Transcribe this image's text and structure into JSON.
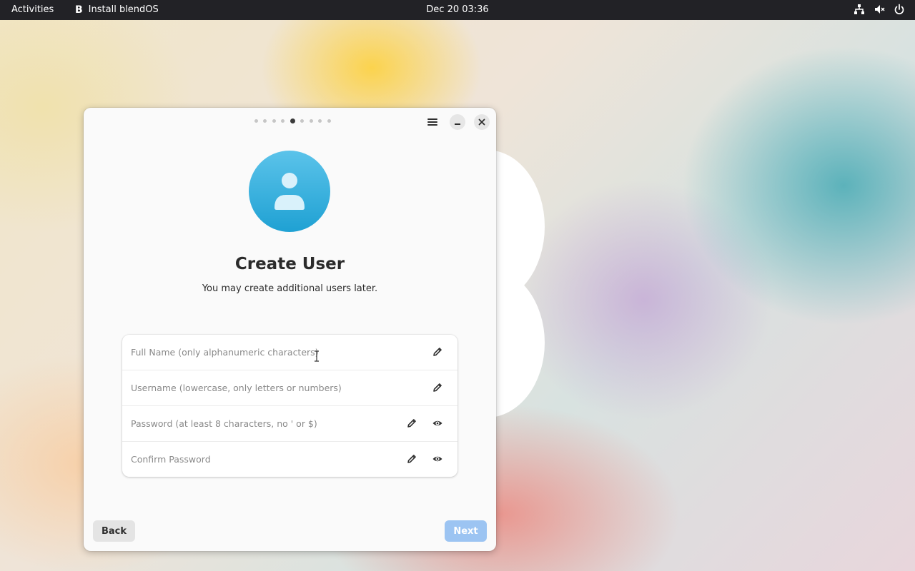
{
  "topbar": {
    "activities": "Activities",
    "app_name": "Install blendOS",
    "app_icon_letter": "B",
    "clock": "Dec 20  03:36",
    "tray_icons": [
      "network-icon",
      "volume-muted-icon",
      "power-icon"
    ]
  },
  "installer": {
    "page_indicator": {
      "total": 9,
      "current": 5
    },
    "title": "Create User",
    "subtitle": "You may create additional users later.",
    "fields": {
      "full_name": {
        "placeholder": "Full Name (only alphanumeric characters)",
        "value": ""
      },
      "username": {
        "placeholder": "Username (lowercase, only letters or numbers)",
        "value": ""
      },
      "password": {
        "placeholder": "Password (at least 8 characters, no ' or $)",
        "value": ""
      },
      "confirm_password": {
        "placeholder": "Confirm Password",
        "value": ""
      }
    },
    "back_label": "Back",
    "next_label": "Next"
  },
  "colors": {
    "topbar_bg": "#222226",
    "avatar_top": "#5bc3ea",
    "avatar_bottom": "#1fa1d3",
    "next_disabled": "#9cc4f2"
  }
}
